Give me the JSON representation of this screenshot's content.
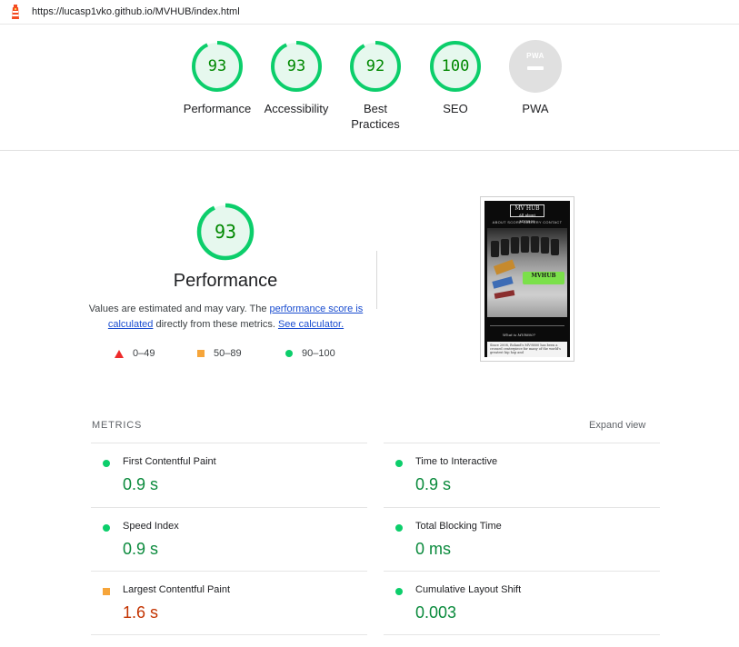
{
  "url": "https://lucasp1vko.github.io/MVHUB/index.html",
  "colors": {
    "pass": "#0cce6b",
    "average": "#f6a53a",
    "fail": "#ee2b2b",
    "pass_text": "#008800"
  },
  "categories": [
    {
      "label": "Performance",
      "score": "93",
      "pct": 0.93
    },
    {
      "label": "Accessibility",
      "score": "93",
      "pct": 0.93
    },
    {
      "label": "Best Practices",
      "score": "92",
      "pct": 0.92
    },
    {
      "label": "SEO",
      "score": "100",
      "pct": 1.0
    },
    {
      "label": "PWA",
      "score": "",
      "icon": "pwa-icon"
    }
  ],
  "performance": {
    "score": "93",
    "pct": 0.93,
    "title": "Performance",
    "desc_prefix": "Values are estimated and may vary. The ",
    "link_score": "performance score is calculated",
    "desc_middle": " directly from these metrics. ",
    "link_calc": "See calculator."
  },
  "legend": [
    {
      "range": "0–49",
      "icon": "triangle"
    },
    {
      "range": "50–89",
      "icon": "square"
    },
    {
      "range": "90–100",
      "icon": "circle"
    }
  ],
  "thumbnail": {
    "logo_line1": "MV HUB",
    "logo_line2": "All about MV8800",
    "nav": "ABOUT   SCORE   GALLERY   CONTACT",
    "badge": "MVHUB",
    "question": "What is MV8800?",
    "text": "Since 2008, Roland's MV-8800 has been a crossed centerpiece for many of the world's greatest hip hop and"
  },
  "metrics_header": {
    "title": "METRICS",
    "expand": "Expand view"
  },
  "metrics": [
    {
      "name": "First Contentful Paint",
      "value": "0.9 s",
      "status": "pass"
    },
    {
      "name": "Time to Interactive",
      "value": "0.9 s",
      "status": "pass"
    },
    {
      "name": "Speed Index",
      "value": "0.9 s",
      "status": "pass"
    },
    {
      "name": "Total Blocking Time",
      "value": "0 ms",
      "status": "pass"
    },
    {
      "name": "Largest Contentful Paint",
      "value": "1.6 s",
      "status": "average"
    },
    {
      "name": "Cumulative Layout Shift",
      "value": "0.003",
      "status": "pass"
    }
  ]
}
